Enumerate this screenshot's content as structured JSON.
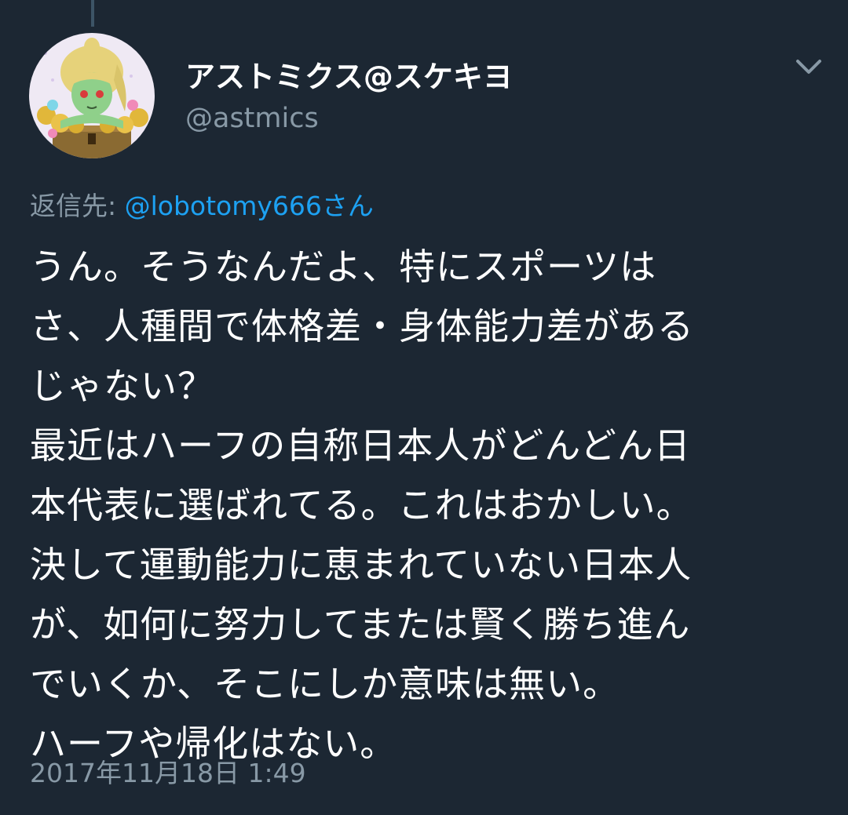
{
  "tweet": {
    "author": {
      "display_name": "アストミクス@スケキヨ",
      "handle": "@astmics",
      "avatar_icon": "avatar-illustration"
    },
    "menu_icon": "chevron-down-icon",
    "reply_to": {
      "prefix": "返信先: ",
      "mention": "@lobotomy666さん"
    },
    "lines": [
      "うん。そうなんだよ、特にスポーツは",
      "さ、人種間で体格差・身体能力差がある",
      "じゃない？",
      "最近はハーフの自称日本人がどんどん日",
      "本代表に選ばれてる。これはおかしい。",
      "決して運動能力に恵まれていない日本人",
      "が、如何に努力してまたは賢く勝ち進ん",
      "でいくか、そこにしか意味は無い。",
      "ハーフや帰化はない。"
    ],
    "timestamp": "2017年11月18日 1:49"
  },
  "colors": {
    "background": "#1c2733",
    "primary_text": "#ffffff",
    "secondary_text": "#8899a6",
    "link": "#1da1f2",
    "thread_line": "#3d5466"
  }
}
